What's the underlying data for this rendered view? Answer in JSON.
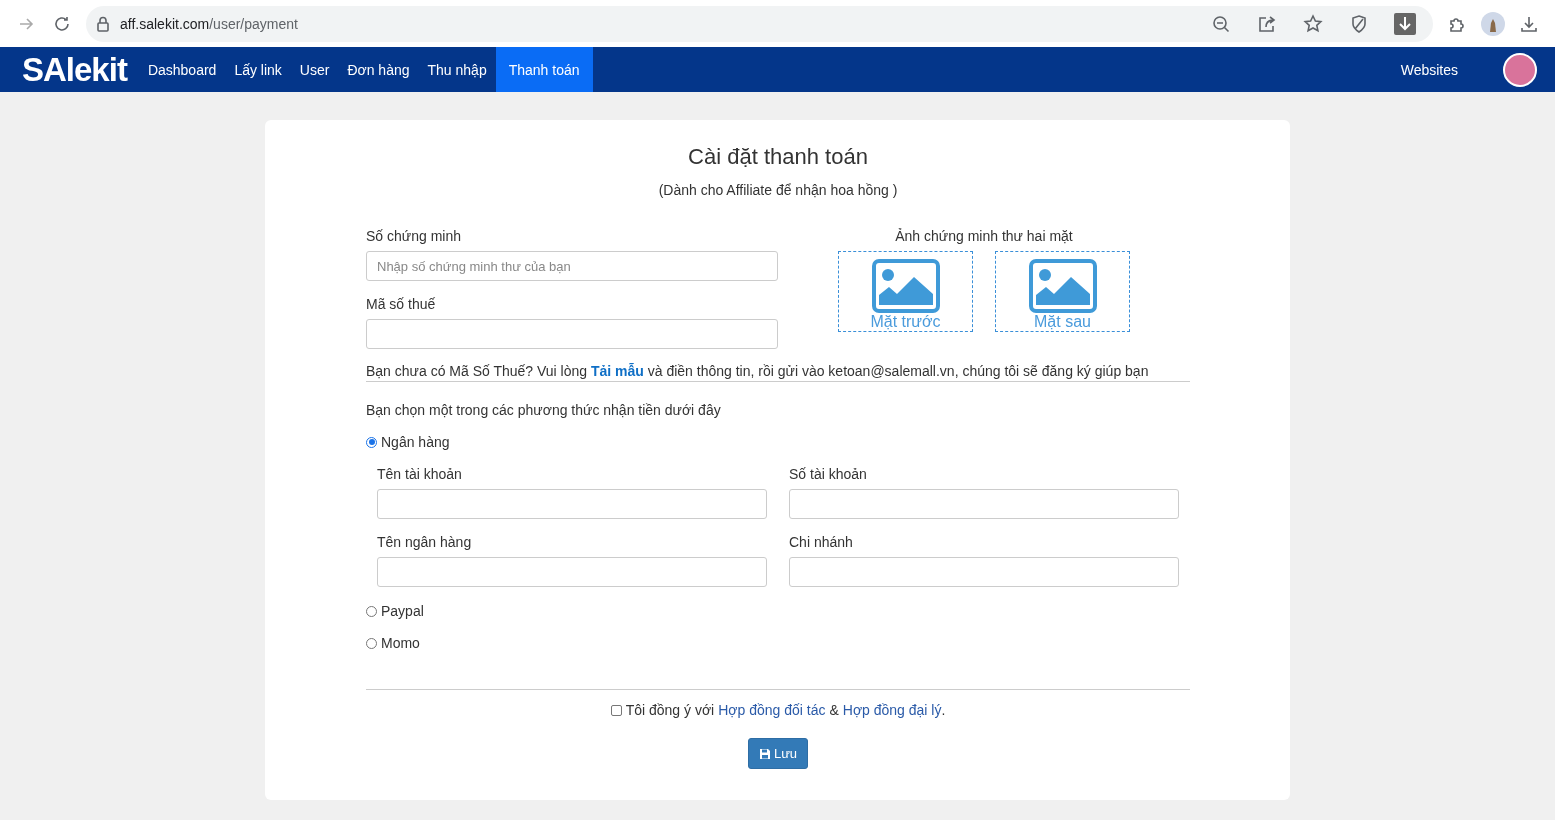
{
  "browser": {
    "url_domain": "aff.salekit.com",
    "url_path": "/user/payment"
  },
  "nav": {
    "logo": "SAlekit",
    "items": [
      {
        "label": "Dashboard",
        "selected": false
      },
      {
        "label": "Lấy link",
        "selected": false
      },
      {
        "label": "User",
        "selected": false
      },
      {
        "label": "Đơn hàng",
        "selected": false
      },
      {
        "label": "Thu nhập",
        "selected": false
      },
      {
        "label": "Thanh toán",
        "selected": true
      }
    ],
    "right_link": "Websites"
  },
  "form": {
    "title": "Cài đặt thanh toán",
    "subtitle": "(Dành cho Affiliate để nhận hoa hồng )",
    "id_label": "Số chứng minh",
    "id_placeholder": "Nhập số chứng minh thư của bạn",
    "tax_label": "Mã số thuế",
    "photos_label": "Ảnh chứng minh thư hai mặt",
    "photos": [
      "Mặt trước",
      "Mặt sau"
    ],
    "tax_note": {
      "before": "Bạn chưa có Mã Số Thuế? Vui lòng",
      "link": "Tải mẫu",
      "after": "và điền thông tin, rồi gửi vào ketoan@salemall.vn, chúng tôi sẽ đăng ký giúp bạn"
    },
    "methods_prompt": "Bạn chọn một trong các phương thức nhận tiền dưới đây",
    "methods": [
      {
        "label": "Ngân hàng",
        "selected": true,
        "fields": [
          "Tên tài khoản",
          "Số tài khoản",
          "Tên ngân hàng",
          "Chi nhánh"
        ]
      },
      {
        "label": "Paypal",
        "selected": false
      },
      {
        "label": "Momo",
        "selected": false
      }
    ],
    "agreement": {
      "checked": false,
      "text_1": "Tôi đồng ý với",
      "link_1": "Hợp đồng đối tác",
      "text_2": "&",
      "link_2": "Hợp đồng đại lý",
      "text_3": "."
    },
    "save_button": "Lưu"
  }
}
